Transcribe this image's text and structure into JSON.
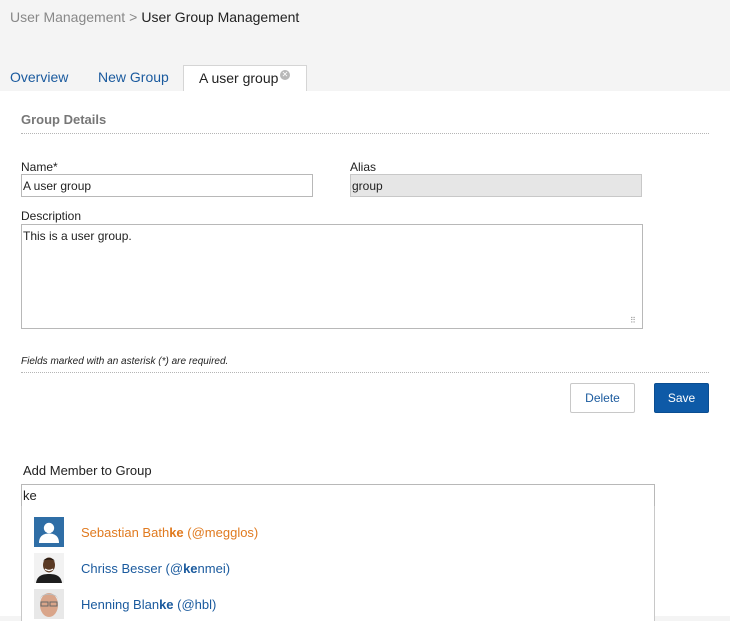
{
  "breadcrumb": {
    "parent": "User Management",
    "separator": ">",
    "current": "User Group Management"
  },
  "tabs": [
    {
      "label": "Overview"
    },
    {
      "label": "New Group"
    },
    {
      "label": "A user group",
      "close_icon": "close-circle-icon"
    }
  ],
  "form": {
    "section_title": "Group Details",
    "name_label": "Name*",
    "name_value": "A user group",
    "alias_label": "Alias",
    "alias_value": "group",
    "description_label": "Description",
    "description_value": "This is a user group.",
    "required_hint": "Fields marked with an asterisk (*) are required."
  },
  "actions": {
    "delete_label": "Delete",
    "save_label": "Save"
  },
  "members": {
    "label": "Add Member to Group",
    "query": "ke",
    "suggestions": [
      {
        "name_before": "Sebastian Bath",
        "match": "ke",
        "name_after": "",
        "handle_before": " (@megglos)",
        "handle_match": "",
        "handle_after": "",
        "highlighted": true
      },
      {
        "name_before": "Chriss Besser",
        "match": "",
        "name_after": "",
        "handle_before": " (@",
        "handle_match": "ke",
        "handle_after": "nmei)",
        "highlighted": false
      },
      {
        "name_before": "Henning Blan",
        "match": "ke",
        "name_after": "",
        "handle_before": " (@hbl)",
        "handle_match": "",
        "handle_after": "",
        "highlighted": false
      }
    ]
  },
  "colors": {
    "link": "#1a5a9e",
    "highlight": "#e07a1f",
    "primary_button": "#0e5aa7"
  }
}
